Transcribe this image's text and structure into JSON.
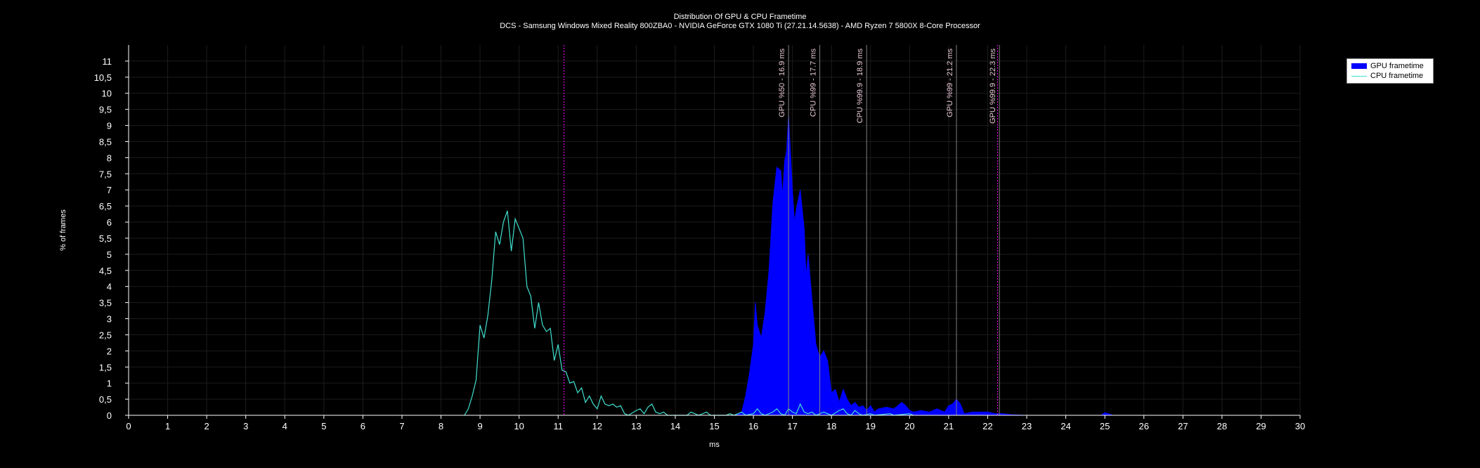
{
  "chart_data": {
    "type": "area",
    "title": "Distribution Of GPU & CPU Frametime",
    "subtitle": "DCS - Samsung Windows Mixed Reality 800ZBA0 - NVIDIA GeForce GTX 1080 Ti (27.21.14.5638) - AMD Ryzen 7 5800X 8-Core Processor",
    "xlabel": "ms",
    "ylabel": "% of frames",
    "xlim": [
      0,
      30
    ],
    "ylim": [
      0,
      11.5
    ],
    "x_ticks": [
      0,
      1,
      2,
      3,
      4,
      5,
      6,
      7,
      8,
      9,
      10,
      11,
      12,
      13,
      14,
      15,
      16,
      17,
      18,
      19,
      20,
      21,
      22,
      23,
      24,
      25,
      26,
      27,
      28,
      29,
      30
    ],
    "y_ticks": [
      "0",
      "0,5",
      "1",
      "1,5",
      "2",
      "2,5",
      "3",
      "3,5",
      "4",
      "4,5",
      "5",
      "5,5",
      "6",
      "6,5",
      "7",
      "7,5",
      "8",
      "8,5",
      "9",
      "9,5",
      "10",
      "10,5",
      "11"
    ],
    "grid": true,
    "legend_position": "top-right",
    "series": [
      {
        "name": "GPU frametime",
        "style": "area",
        "color": "#0000ff",
        "points": [
          [
            15.5,
            0
          ],
          [
            15.7,
            0.1
          ],
          [
            15.8,
            0.6
          ],
          [
            15.9,
            1.3
          ],
          [
            16.0,
            2.2
          ],
          [
            16.05,
            3.5
          ],
          [
            16.1,
            2.8
          ],
          [
            16.2,
            2.4
          ],
          [
            16.3,
            3.2
          ],
          [
            16.4,
            4.5
          ],
          [
            16.5,
            6.6
          ],
          [
            16.6,
            7.7
          ],
          [
            16.7,
            7.6
          ],
          [
            16.75,
            6.8
          ],
          [
            16.8,
            7.9
          ],
          [
            16.85,
            8.2
          ],
          [
            16.9,
            9.3
          ],
          [
            17.0,
            7.0
          ],
          [
            17.05,
            6.0
          ],
          [
            17.1,
            6.4
          ],
          [
            17.2,
            7.0
          ],
          [
            17.3,
            5.8
          ],
          [
            17.35,
            4.3
          ],
          [
            17.4,
            5.0
          ],
          [
            17.5,
            3.6
          ],
          [
            17.6,
            2.2
          ],
          [
            17.7,
            1.8
          ],
          [
            17.8,
            2.0
          ],
          [
            17.9,
            1.7
          ],
          [
            18.0,
            0.7
          ],
          [
            18.1,
            0.8
          ],
          [
            18.2,
            0.4
          ],
          [
            18.3,
            0.8
          ],
          [
            18.4,
            0.5
          ],
          [
            18.5,
            0.3
          ],
          [
            18.6,
            0.4
          ],
          [
            18.7,
            0.25
          ],
          [
            18.8,
            0.3
          ],
          [
            18.9,
            0.15
          ],
          [
            19.0,
            0.3
          ],
          [
            19.1,
            0.1
          ],
          [
            19.2,
            0.2
          ],
          [
            19.4,
            0.25
          ],
          [
            19.6,
            0.2
          ],
          [
            19.8,
            0.4
          ],
          [
            19.9,
            0.3
          ],
          [
            20.0,
            0.15
          ],
          [
            20.1,
            0.1
          ],
          [
            20.3,
            0.15
          ],
          [
            20.5,
            0.1
          ],
          [
            20.7,
            0.2
          ],
          [
            20.9,
            0.1
          ],
          [
            21.0,
            0.3
          ],
          [
            21.1,
            0.35
          ],
          [
            21.2,
            0.5
          ],
          [
            21.3,
            0.35
          ],
          [
            21.4,
            0.05
          ],
          [
            21.6,
            0.1
          ],
          [
            22.0,
            0.1
          ],
          [
            22.2,
            0.05
          ],
          [
            22.4,
            0.05
          ],
          [
            22.6,
            0.02
          ],
          [
            23.0,
            0
          ],
          [
            24.9,
            0
          ],
          [
            25.0,
            0.08
          ],
          [
            25.1,
            0.05
          ],
          [
            25.2,
            0
          ]
        ]
      },
      {
        "name": "CPU frametime",
        "style": "line",
        "color": "#40e0d0",
        "points": [
          [
            8.6,
            0
          ],
          [
            8.7,
            0.2
          ],
          [
            8.8,
            0.6
          ],
          [
            8.9,
            1.1
          ],
          [
            9.0,
            2.8
          ],
          [
            9.1,
            2.4
          ],
          [
            9.2,
            3.1
          ],
          [
            9.3,
            4.2
          ],
          [
            9.4,
            5.7
          ],
          [
            9.5,
            5.3
          ],
          [
            9.6,
            6.0
          ],
          [
            9.7,
            6.35
          ],
          [
            9.8,
            5.1
          ],
          [
            9.9,
            6.1
          ],
          [
            10.0,
            5.8
          ],
          [
            10.1,
            5.5
          ],
          [
            10.2,
            4.0
          ],
          [
            10.3,
            3.7
          ],
          [
            10.4,
            2.7
          ],
          [
            10.5,
            3.5
          ],
          [
            10.6,
            2.8
          ],
          [
            10.7,
            2.6
          ],
          [
            10.8,
            2.7
          ],
          [
            10.9,
            1.7
          ],
          [
            11.0,
            2.2
          ],
          [
            11.1,
            1.4
          ],
          [
            11.2,
            1.35
          ],
          [
            11.3,
            1.0
          ],
          [
            11.4,
            1.05
          ],
          [
            11.5,
            0.7
          ],
          [
            11.6,
            0.85
          ],
          [
            11.7,
            0.4
          ],
          [
            11.8,
            0.6
          ],
          [
            11.9,
            0.35
          ],
          [
            12.0,
            0.2
          ],
          [
            12.1,
            0.6
          ],
          [
            12.2,
            0.35
          ],
          [
            12.3,
            0.3
          ],
          [
            12.4,
            0.35
          ],
          [
            12.5,
            0.25
          ],
          [
            12.6,
            0.3
          ],
          [
            12.7,
            0.05
          ],
          [
            12.8,
            0
          ],
          [
            13.0,
            0.15
          ],
          [
            13.1,
            0.2
          ],
          [
            13.2,
            0.05
          ],
          [
            13.3,
            0.25
          ],
          [
            13.4,
            0.35
          ],
          [
            13.5,
            0.1
          ],
          [
            13.6,
            0.05
          ],
          [
            13.7,
            0.1
          ],
          [
            13.8,
            0
          ],
          [
            14.3,
            0
          ],
          [
            14.4,
            0.1
          ],
          [
            14.5,
            0.05
          ],
          [
            14.6,
            0
          ],
          [
            14.8,
            0.1
          ],
          [
            14.9,
            0
          ],
          [
            15.3,
            0
          ],
          [
            15.4,
            0.05
          ],
          [
            15.5,
            0
          ],
          [
            15.7,
            0.1
          ],
          [
            15.8,
            0
          ],
          [
            16.0,
            0.05
          ],
          [
            16.1,
            0.2
          ],
          [
            16.2,
            0.05
          ],
          [
            16.3,
            0
          ],
          [
            16.5,
            0.1
          ],
          [
            16.6,
            0.2
          ],
          [
            16.7,
            0.05
          ],
          [
            16.8,
            0
          ],
          [
            16.9,
            0.2
          ],
          [
            17.0,
            0.1
          ],
          [
            17.1,
            0.05
          ],
          [
            17.2,
            0.35
          ],
          [
            17.3,
            0.1
          ],
          [
            17.4,
            0.05
          ],
          [
            17.5,
            0.1
          ],
          [
            17.6,
            0
          ],
          [
            17.8,
            0.1
          ],
          [
            17.9,
            0.05
          ],
          [
            18.0,
            0
          ],
          [
            18.2,
            0.15
          ],
          [
            18.3,
            0.2
          ],
          [
            18.4,
            0.05
          ],
          [
            18.5,
            0
          ],
          [
            18.6,
            0.15
          ],
          [
            18.7,
            0.05
          ],
          [
            18.8,
            0
          ],
          [
            19.0,
            0.05
          ],
          [
            19.1,
            0
          ],
          [
            19.5,
            0.05
          ],
          [
            19.6,
            0
          ],
          [
            20.0,
            0.05
          ],
          [
            20.1,
            0
          ]
        ]
      }
    ],
    "markers": [
      {
        "x": 11.15,
        "label": "",
        "color": "#ff00ff",
        "dashed": true
      },
      {
        "x": 16.9,
        "label": "GPU %50 - 16.9 ms",
        "color": "#808080",
        "dashed": false
      },
      {
        "x": 17.7,
        "label": "CPU %99 - 17.7 ms",
        "color": "#808080",
        "dashed": false
      },
      {
        "x": 18.9,
        "label": "CPU %99.9 - 18.9  ms",
        "color": "#808080",
        "dashed": false
      },
      {
        "x": 21.2,
        "label": "GPU %99 - 21.2 ms",
        "color": "#808080",
        "dashed": false
      },
      {
        "x": 22.3,
        "label": "GPU %99.9 - 22.3 ms",
        "color": "#808080",
        "dashed": false
      },
      {
        "x": 22.25,
        "label": "",
        "color": "#ff00ff",
        "dashed": true
      }
    ]
  }
}
